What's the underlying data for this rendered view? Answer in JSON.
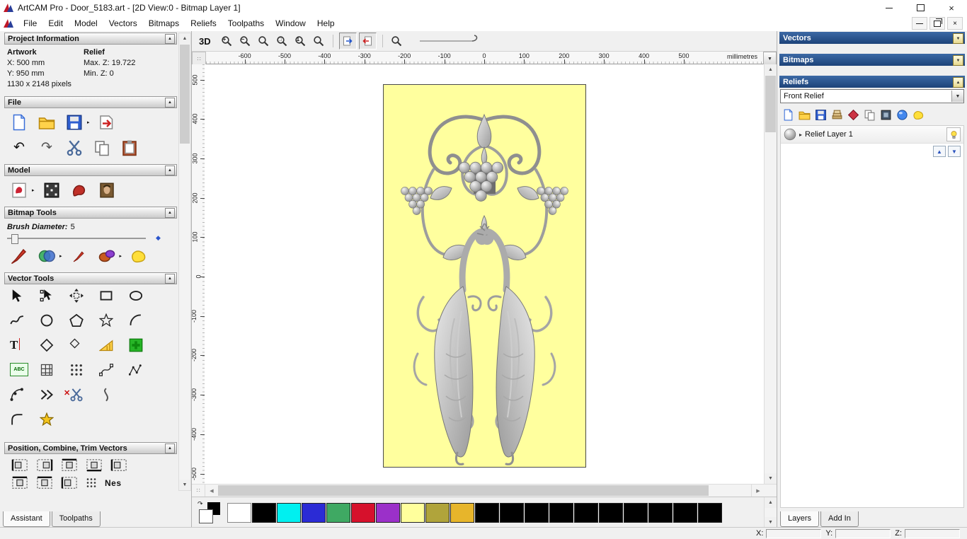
{
  "window": {
    "title": "ArtCAM Pro - Door_5183.art - [2D View:0 - Bitmap Layer 1]"
  },
  "menubar": {
    "items": [
      "File",
      "Edit",
      "Model",
      "Vectors",
      "Bitmaps",
      "Reliefs",
      "Toolpaths",
      "Window",
      "Help"
    ]
  },
  "left_panel": {
    "project_information": {
      "header": "Project Information",
      "artwork_label": "Artwork",
      "x_value": "X: 500 mm",
      "y_value": "Y: 950 mm",
      "pixels": "1130 x 2148 pixels",
      "relief_label": "Relief",
      "max_z": "Max. Z: 19.722",
      "min_z": "Min. Z: 0"
    },
    "file_header": "File",
    "model_header": "Model",
    "bitmap_tools_header": "Bitmap Tools",
    "brush_diameter_label": "Brush Diameter:",
    "brush_diameter_value": "5",
    "vector_tools_header": "Vector Tools",
    "position_header": "Position, Combine, Trim Vectors",
    "abc_icon_label": "ABC",
    "text_tool_label": "T",
    "nes_icon_label": "Nes",
    "tabs": [
      {
        "label": "Assistant",
        "active": true
      },
      {
        "label": "Toolpaths",
        "active": false
      }
    ]
  },
  "canvas": {
    "toolbar": {
      "view_3d_label": "3D"
    },
    "ruler": {
      "unit": "millimetres",
      "h_ticks": [
        -600,
        -500,
        -400,
        -300,
        -200,
        -100,
        0,
        100,
        200,
        300,
        400,
        500
      ],
      "v_ticks": [
        500,
        400,
        300,
        200,
        100,
        0,
        -100,
        -200,
        -300,
        -400,
        -500
      ]
    },
    "artwork_background": "#ffff9e"
  },
  "palette": {
    "colors": [
      "#ffffff",
      "#000000",
      "#00f0f0",
      "#2b2bd5",
      "#3fa963",
      "#d6112c",
      "#9b30c9",
      "#ffff9c",
      "#b0a43b",
      "#e7b52b",
      "#000000",
      "#000000",
      "#000000",
      "#000000",
      "#000000",
      "#000000",
      "#000000",
      "#000000",
      "#000000",
      "#000000"
    ]
  },
  "right_panel": {
    "vectors_header": "Vectors",
    "bitmaps_header": "Bitmaps",
    "reliefs_header": "Reliefs",
    "relief_select_value": "Front Relief",
    "layer_name": "Relief Layer 1",
    "tabs": [
      {
        "label": "Layers",
        "active": true
      },
      {
        "label": "Add In",
        "active": false
      }
    ]
  },
  "statusbar": {
    "x_label": "X:",
    "y_label": "Y:",
    "z_label": "Z:"
  },
  "glyphs": {
    "up": "▲",
    "down": "▼",
    "left": "◀",
    "right": "▶",
    "flyout": "▸",
    "undo": "↶",
    "redo": "↷",
    "close": "×",
    "diamond": "◆",
    "dots": "∷"
  },
  "colors": {
    "header_blue": "#24518f",
    "selection_yellow": "#ffff9e",
    "accent_green": "#27b527"
  },
  "icons": {
    "file_toolbar": [
      "new-model-icon",
      "open-model-icon",
      "save-model-icon",
      "import-model-icon",
      "undo-icon",
      "redo-icon",
      "cut-icon",
      "copy-icon",
      "paste-icon"
    ],
    "model_toolbar": [
      "greeting-card-icon",
      "set-model-size-icon",
      "relief-stamp-icon",
      "load-bitmap-icon"
    ],
    "bitmap_toolbar": [
      "paint-icon",
      "colour-palette-icon",
      "draw-icon",
      "shape-editor-icon",
      "flood-fill-icon"
    ],
    "vector_toolbar": [
      "select-vectors-icon",
      "node-editing-icon",
      "transform-vectors-icon",
      "create-rectangle-icon",
      "create-ellipse-icon",
      "create-polyline-icon",
      "create-circle-icon",
      "create-polygon-icon",
      "create-star-icon",
      "create-arc-icon",
      "create-text-icon",
      "measure-icon",
      "create-diamond-icon",
      "offset-vectors-icon",
      "paste-vectors-icon",
      "text-block-icon",
      "paragraph-text-icon",
      "block-copy-icon",
      "fit-curve-icon",
      "fit-polyline-icon",
      "arc-fit-icon",
      "join-vectors-icon",
      "trim-vectors-icon",
      "section-profile-icon",
      "fillet-icon",
      "vector-doctor-icon"
    ],
    "reliefs_toolbar": [
      "new-relief-icon",
      "load-relief-icon",
      "save-relief-icon",
      "relief-library-icon",
      "delete-relief-icon",
      "duplicate-relief-icon",
      "relief-properties-icon",
      "sculpt-relief-icon",
      "relief-tools-icon"
    ],
    "view_toolbar": [
      "zoom-in-icon",
      "zoom-out-icon",
      "zoom-previous-icon",
      "zoom-box-icon",
      "zoom-1to1-icon",
      "zoom-fit-icon",
      "snap-left-icon",
      "snap-right-icon",
      "zoom-object-icon",
      "line-preview-icon"
    ]
  }
}
